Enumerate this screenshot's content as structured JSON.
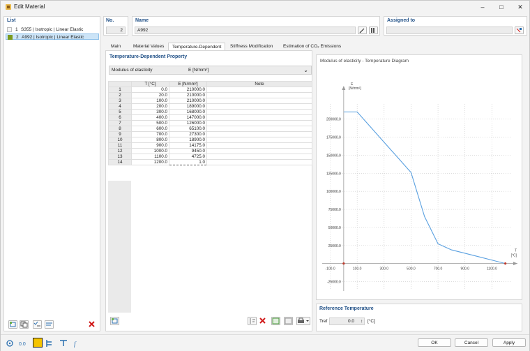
{
  "window": {
    "title": "Edit Material"
  },
  "list": {
    "header": "List",
    "items": [
      {
        "number": "1",
        "label": "S355 | Isotropic | Linear Elastic",
        "swatch": "#f5f5f5"
      },
      {
        "number": "2",
        "label": "A992 | Isotropic | Linear Elastic",
        "swatch": "#7a9a1e"
      }
    ]
  },
  "fields": {
    "no_label": "No.",
    "no_value": "2",
    "name_label": "Name",
    "name_value": "A992",
    "assigned_label": "Assigned to",
    "assigned_value": ""
  },
  "tabs": [
    {
      "label": "Main"
    },
    {
      "label": "Material Values"
    },
    {
      "label": "Temperature-Dependent"
    },
    {
      "label": "Stiffness Modification"
    },
    {
      "label": "Estimation of CO₂ Emissions"
    }
  ],
  "property": {
    "header": "Temperature-Dependent Property",
    "select_name": "Modulus of elasticity",
    "select_unit": "E [N/mm²]"
  },
  "table": {
    "columns": [
      "T [°C]",
      "E [N/mm²]",
      "Note"
    ],
    "rows": [
      {
        "n": "1",
        "t": "0.0",
        "e": "210000.0"
      },
      {
        "n": "2",
        "t": "20.0",
        "e": "210000.0"
      },
      {
        "n": "3",
        "t": "100.0",
        "e": "210000.0"
      },
      {
        "n": "4",
        "t": "200.0",
        "e": "189000.0"
      },
      {
        "n": "5",
        "t": "300.0",
        "e": "168000.0"
      },
      {
        "n": "6",
        "t": "400.0",
        "e": "147000.0"
      },
      {
        "n": "7",
        "t": "500.0",
        "e": "126000.0"
      },
      {
        "n": "8",
        "t": "600.0",
        "e": "65100.0"
      },
      {
        "n": "9",
        "t": "700.0",
        "e": "27300.0"
      },
      {
        "n": "10",
        "t": "800.0",
        "e": "18900.0"
      },
      {
        "n": "11",
        "t": "900.0",
        "e": "14175.0"
      },
      {
        "n": "12",
        "t": "1000.0",
        "e": "9450.0"
      },
      {
        "n": "13",
        "t": "1100.0",
        "e": "4725.0"
      },
      {
        "n": "14",
        "t": "1200.0",
        "e": "1.0"
      }
    ]
  },
  "chart_data": {
    "type": "line",
    "title": "Modulus of elasticity - Temperature Diagram",
    "xlabel": "T [°C]",
    "ylabel": "E [N/mm²]",
    "x_ticks": [
      "-100.0",
      "100.0",
      "300.0",
      "500.0",
      "700.0",
      "900.0",
      "1100.0"
    ],
    "y_ticks": [
      "-25000.0",
      "25000.0",
      "50000.0",
      "75000.0",
      "100000.0",
      "125000.0",
      "150000.0",
      "175000.0",
      "200000.0"
    ],
    "xlim": [
      -170,
      1300
    ],
    "ylim": [
      -40000,
      250000
    ],
    "x": [
      0,
      20,
      100,
      200,
      300,
      400,
      500,
      600,
      700,
      800,
      900,
      1000,
      1100,
      1200
    ],
    "y": [
      210000,
      210000,
      210000,
      189000,
      168000,
      147000,
      126000,
      65100,
      27300,
      18900,
      14175,
      9450,
      4725,
      1
    ],
    "line_color": "#5aa0e0",
    "grid": true
  },
  "reference": {
    "header": "Reference Temperature",
    "label": "Tref",
    "value": "0.0",
    "unit": "[°C]"
  },
  "buttons": {
    "ok": "OK",
    "cancel": "Cancel",
    "apply": "Apply"
  },
  "colors": {
    "accent": "#1f4f86",
    "selected_row": "#cce4f7",
    "delete_red": "#d11a1a",
    "yellow": "#f5c400"
  }
}
